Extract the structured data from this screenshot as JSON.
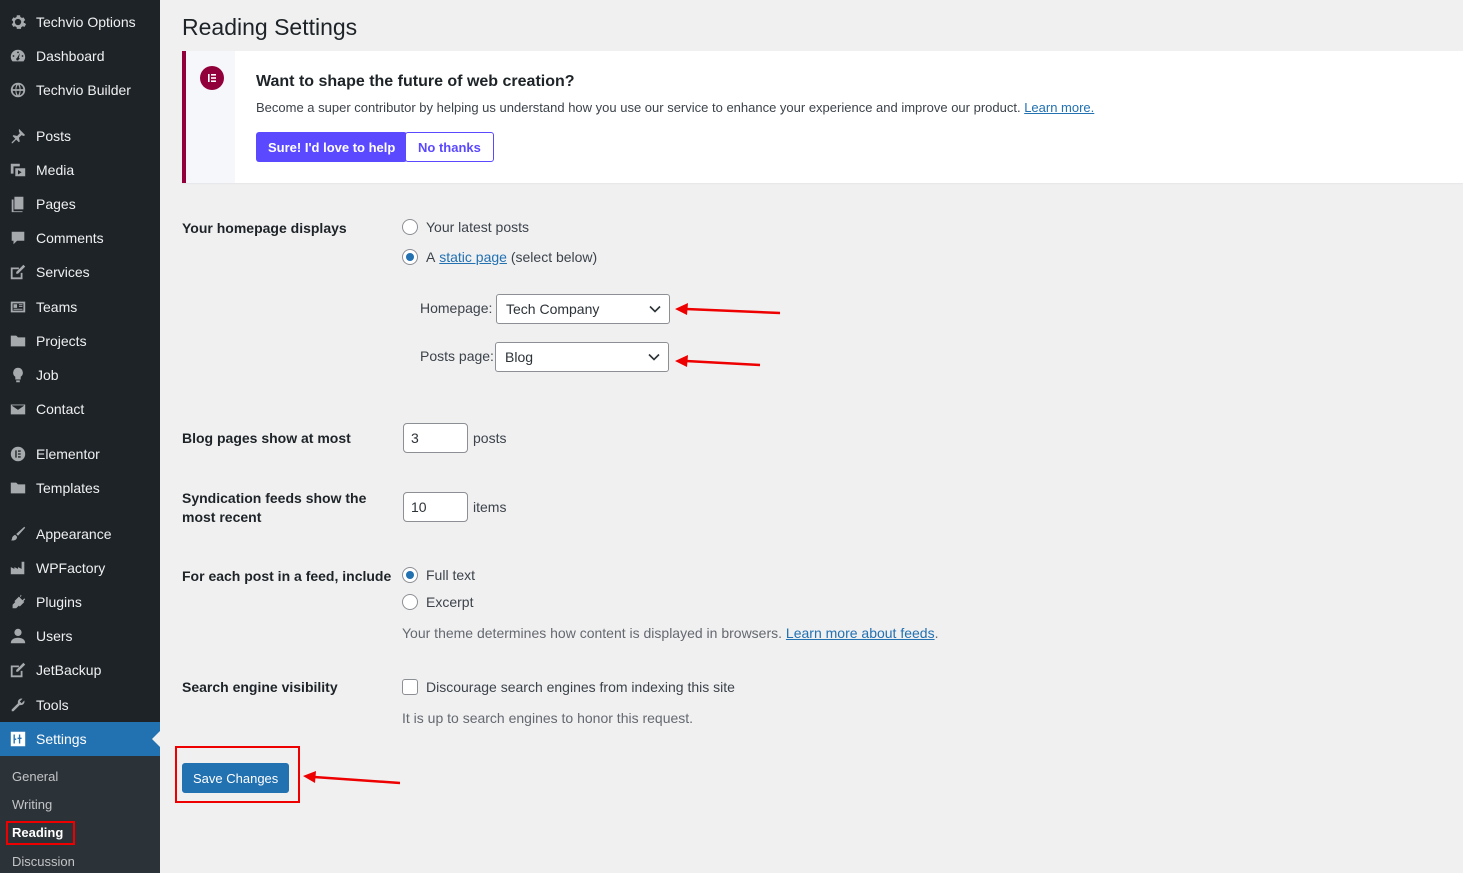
{
  "sidebar": {
    "items": [
      {
        "label": "Techvio Options",
        "icon": "gear-icon"
      },
      {
        "label": "Dashboard",
        "icon": "dashboard-icon"
      },
      {
        "label": "Techvio Builder",
        "icon": "globe-icon"
      },
      {
        "label": "Posts",
        "icon": "pin-icon"
      },
      {
        "label": "Media",
        "icon": "media-icon"
      },
      {
        "label": "Pages",
        "icon": "pages-icon"
      },
      {
        "label": "Comments",
        "icon": "comment-icon"
      },
      {
        "label": "Services",
        "icon": "edit-icon"
      },
      {
        "label": "Teams",
        "icon": "id-card-icon"
      },
      {
        "label": "Projects",
        "icon": "folder-icon"
      },
      {
        "label": "Job",
        "icon": "lightbulb-icon"
      },
      {
        "label": "Contact",
        "icon": "email-icon"
      },
      {
        "label": "Elementor",
        "icon": "elementor-icon"
      },
      {
        "label": "Templates",
        "icon": "folder-icon"
      },
      {
        "label": "Appearance",
        "icon": "brush-icon"
      },
      {
        "label": "WPFactory",
        "icon": "factory-icon"
      },
      {
        "label": "Plugins",
        "icon": "plugin-icon"
      },
      {
        "label": "Users",
        "icon": "user-icon"
      },
      {
        "label": "JetBackup",
        "icon": "backup-icon"
      },
      {
        "label": "Tools",
        "icon": "wrench-icon"
      },
      {
        "label": "Settings",
        "icon": "settings-icon"
      }
    ],
    "submenu": [
      "General",
      "Writing",
      "Reading",
      "Discussion"
    ]
  },
  "page": {
    "title": "Reading Settings"
  },
  "notice": {
    "title": "Want to shape the future of web creation?",
    "text": "Become a super contributor by helping us understand how you use our service to enhance your experience and improve our product.",
    "link": "Learn more.",
    "primary_button": "Sure! I'd love to help",
    "secondary_button": "No thanks"
  },
  "homepage": {
    "label": "Your homepage displays",
    "option_latest": "Your latest posts",
    "option_static_prefix": "A",
    "option_static_link": "static page",
    "option_static_suffix": "(select below)",
    "homepage_label": "Homepage:",
    "homepage_value": "Tech Company",
    "postspage_label": "Posts page:",
    "postspage_value": "Blog"
  },
  "blog_pages": {
    "label": "Blog pages show at most",
    "value": "3",
    "unit": "posts"
  },
  "feeds": {
    "label": "Syndication feeds show the most recent",
    "value": "10",
    "unit": "items"
  },
  "feed_include": {
    "label": "For each post in a feed, include",
    "option_full": "Full text",
    "option_excerpt": "Excerpt",
    "desc": "Your theme determines how content is displayed in browsers.",
    "desc_link": "Learn more about feeds"
  },
  "search": {
    "label": "Search engine visibility",
    "checkbox_label": "Discourage search engines from indexing this site",
    "desc": "It is up to search engines to honor this request."
  },
  "save_button": "Save Changes",
  "colors": {
    "accent": "#2271b1",
    "sidebar": "#1d2327",
    "notice_brand": "#92003b",
    "notice_button": "#5b49ff",
    "annotation": "#e00000"
  }
}
